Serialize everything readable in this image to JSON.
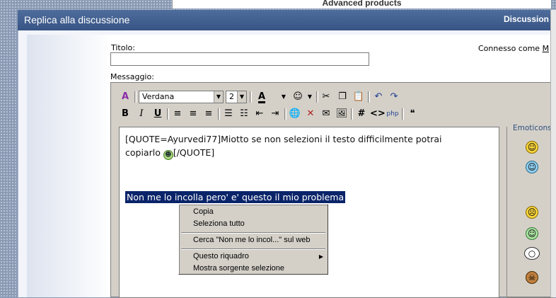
{
  "banner": {
    "text": "Advanced products"
  },
  "header": {
    "title": "Replica alla discussione",
    "right_label": "Discussion"
  },
  "form": {
    "title_label": "Titolo:",
    "title_value": "",
    "message_label": "Messaggio:",
    "logged_in_prefix": "Connesso come ",
    "logged_in_user": "M"
  },
  "toolbar": {
    "font_name": "Verdana",
    "font_size": "2"
  },
  "editor": {
    "quote_part1": "[QUOTE=Ayurvedi77]Miotto se non selezioni il testo difficilmente potrai copiarlo ",
    "quote_part2": "[/QUOTE]",
    "selected_text": "Non me lo incolla pero' e' questo il mio problema "
  },
  "emoticons": {
    "legend": "Emoticons"
  },
  "context_menu": {
    "copy": "Copia",
    "select_all": "Seleziona tutto",
    "search_web": "Cerca \"Non me lo incol...\" sul web",
    "this_frame": "Questo riquadro",
    "view_source": "Mostra sorgente selezione"
  },
  "colors": {
    "header_bg": "#375484",
    "selection_bg": "#0a246a",
    "menu_bg": "#d4d0c8"
  }
}
